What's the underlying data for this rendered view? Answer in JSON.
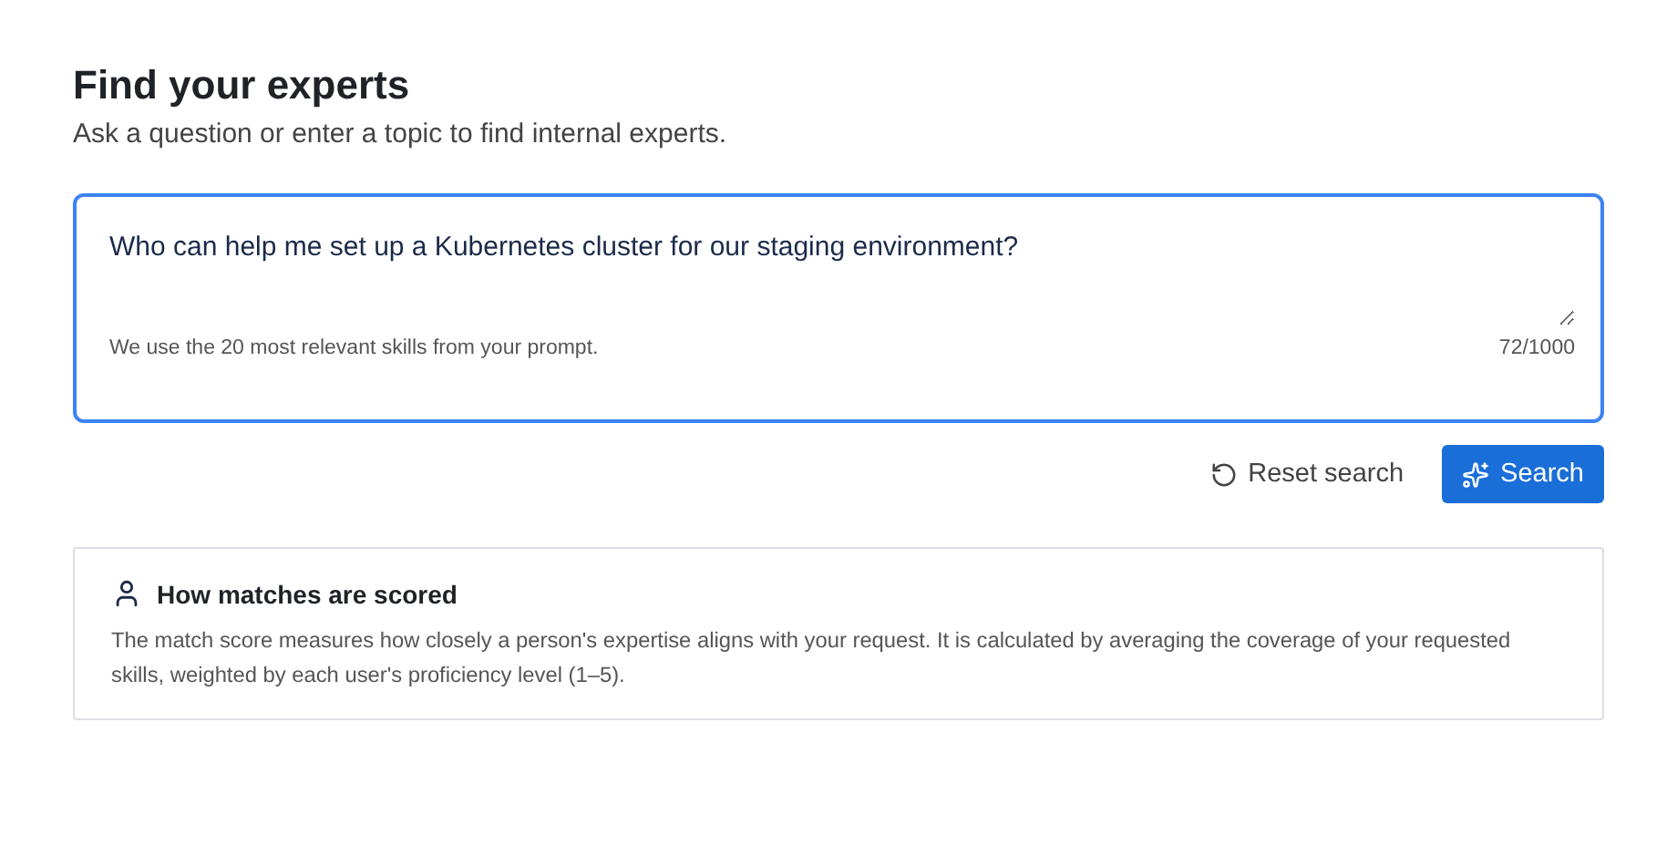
{
  "title": "Find your experts",
  "subtitle": "Ask a question or enter a topic to find internal experts.",
  "prompt": {
    "value": "Who can help me set up a Kubernetes cluster for our staging environment?",
    "focused": true,
    "hint": "We use the 20 most relevant skills from your prompt.",
    "counter": "72/1000"
  },
  "actions": [
    {
      "kind": "reset",
      "label": "Reset search"
    },
    {
      "kind": "search",
      "label": "Search"
    }
  ],
  "info": {
    "title": "How matches are scored",
    "body": "The match score measures how closely a person's expertise aligns with your request. It is calculated by averaging the coverage of your requested skills, weighted by each user's proficiency level (1–5)."
  }
}
